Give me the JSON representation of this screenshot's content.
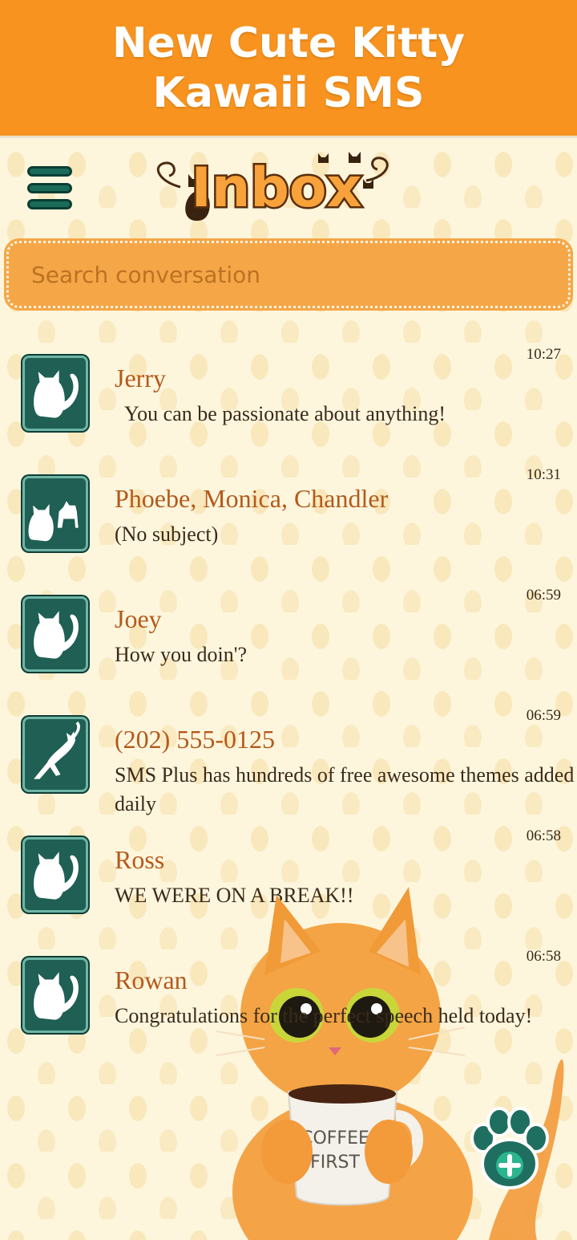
{
  "banner": {
    "line1": "New Cute Kitty",
    "line2": "Kawaii SMS"
  },
  "header": {
    "title": "Inbox",
    "menu_icon": "hamburger-menu-icon"
  },
  "search": {
    "placeholder": "Search conversation"
  },
  "conversations": [
    {
      "name": "Jerry",
      "snippet": "You can be passionate about anything!",
      "time": "10:27"
    },
    {
      "name": "Phoebe, Monica, Chandler",
      "snippet": "(No subject)",
      "time": "10:31"
    },
    {
      "name": "Joey",
      "snippet": "How you doin'?",
      "time": "06:59"
    },
    {
      "name": "(202) 555-0125",
      "snippet": "SMS Plus has hundreds of free awesome themes added daily",
      "time": "06:59"
    },
    {
      "name": "Ross",
      "snippet": "WE WERE ON A BREAK!!",
      "time": "06:58"
    },
    {
      "name": "Rowan",
      "snippet": "Congratulations for the perfect speech held today!",
      "time": "06:58"
    }
  ],
  "mug": {
    "line1": "COFFEE",
    "line2": "FIRST"
  },
  "colors": {
    "banner": "#f7931e",
    "background": "#fdf6dd",
    "search": "#f5a647",
    "contact_name": "#b5591b",
    "avatar": "#1f5f54"
  },
  "fab": {
    "icon": "paw-plus-icon"
  }
}
